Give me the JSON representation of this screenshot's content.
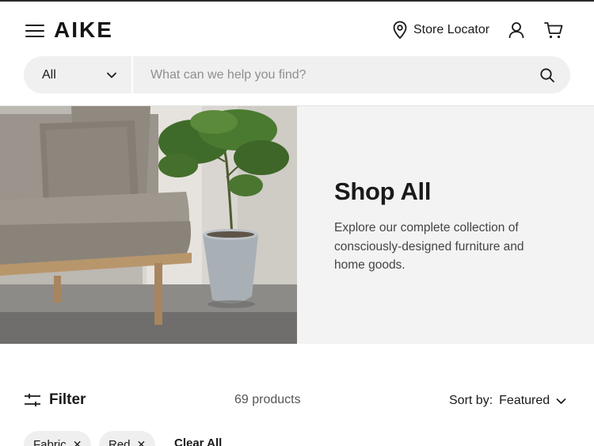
{
  "header": {
    "logo": "AIKE",
    "store_locator_label": "Store Locator",
    "icons": [
      "menu-icon",
      "map-pin-icon",
      "account-icon",
      "cart-icon"
    ]
  },
  "search": {
    "category_value": "All",
    "placeholder": "What can we help you find?"
  },
  "hero": {
    "title": "Shop All",
    "description": "Explore our complete collection of consciously-designed furniture and home goods."
  },
  "toolbar": {
    "filter_label": "Filter",
    "product_count": "69 products",
    "sort_label": "Sort by:",
    "sort_value": "Featured"
  },
  "active_filters": {
    "chips": [
      {
        "label": "Fabric"
      },
      {
        "label": "Red"
      }
    ],
    "clear_all": "Clear All"
  },
  "colors": {
    "text": "#1a1a1a",
    "search_bg": "#f0f0f0",
    "hero_panel_bg": "#f3f3f3",
    "chip_bg": "#efefef"
  }
}
